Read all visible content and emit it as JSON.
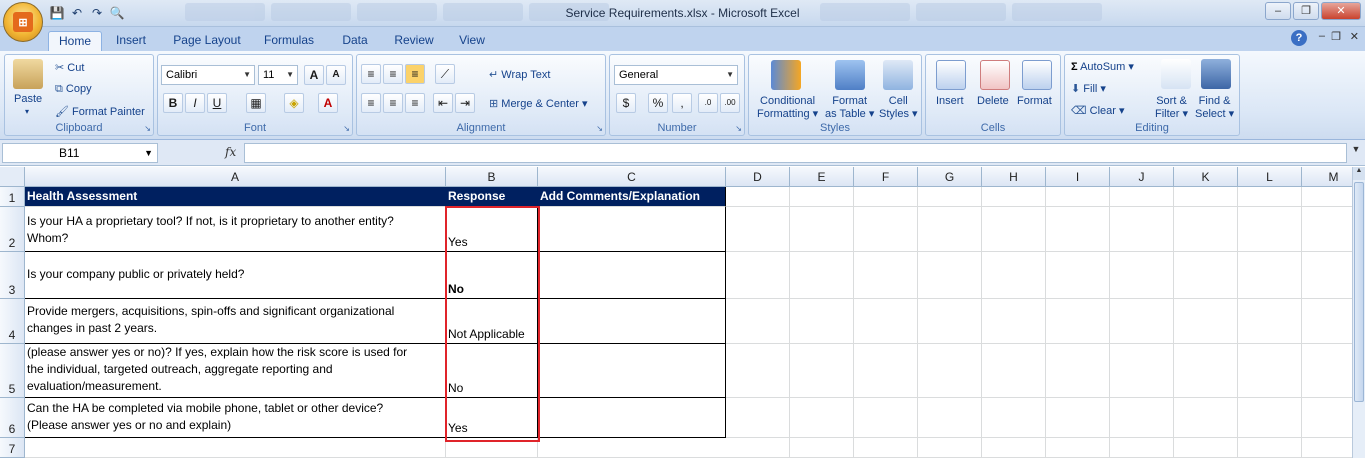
{
  "window": {
    "title": "Service Requirements.xlsx - Microsoft Excel",
    "controls": [
      "–",
      "❐",
      "✕"
    ]
  },
  "ribbon": {
    "tabs": [
      "Home",
      "Insert",
      "Page Layout",
      "Formulas",
      "Data",
      "Review",
      "View"
    ],
    "active_tab": "Home",
    "clipboard": {
      "label": "Clipboard",
      "paste": "Paste",
      "cut": "Cut",
      "copy": "Copy",
      "format_painter": "Format Painter"
    },
    "font": {
      "label": "Font",
      "name": "Calibri",
      "size": "11"
    },
    "alignment": {
      "label": "Alignment",
      "wrap_text": "Wrap Text",
      "merge_center": "Merge & Center"
    },
    "number": {
      "label": "Number",
      "format": "General"
    },
    "styles": {
      "label": "Styles",
      "conditional": "Conditional",
      "conditional2": "Formatting",
      "format_table": "Format",
      "format_table2": "as Table",
      "cell_styles": "Cell",
      "cell_styles2": "Styles"
    },
    "cells": {
      "label": "Cells",
      "insert": "Insert",
      "delete": "Delete",
      "format": "Format"
    },
    "editing": {
      "label": "Editing",
      "autosum": "AutoSum",
      "fill": "Fill",
      "clear": "Clear",
      "sort": "Sort &",
      "sort2": "Filter",
      "find": "Find &",
      "find2": "Select"
    }
  },
  "formula_bar": {
    "name_box": "B11",
    "fx": "fx",
    "value": ""
  },
  "sheet": {
    "columns": [
      "A",
      "B",
      "C",
      "D",
      "E",
      "F",
      "G",
      "H",
      "I",
      "J",
      "K",
      "L",
      "M"
    ],
    "rows": [
      "1",
      "2",
      "3",
      "4",
      "5",
      "6",
      "7"
    ],
    "header": {
      "a": "Health Assessment",
      "b": "Response",
      "c": "Add Comments/Explanation"
    },
    "data": [
      {
        "a1": "Is your HA a proprietary tool? If not, is it proprietary to another entity?",
        "a2": "Whom?",
        "a3": "",
        "b": "Yes"
      },
      {
        "a1": "Is your company public or privately held?",
        "a2": "",
        "a3": "",
        "b": "No"
      },
      {
        "a1": "Provide mergers, acquisitions, spin-offs and significant organizational",
        "a2": "changes in past 2 years.",
        "a3": "",
        "b": "Not Applicable"
      },
      {
        "a1": "(please answer yes or no)? If yes, explain how the risk score is used for",
        "a2": "the individual, targeted outreach, aggregate reporting and",
        "a3": "evaluation/measurement.",
        "b": "No"
      },
      {
        "a1": "Can the HA be completed via mobile phone, tablet or other device?",
        "a2": "(Please answer yes or no and explain)",
        "a3": "",
        "b": "Yes"
      }
    ]
  }
}
